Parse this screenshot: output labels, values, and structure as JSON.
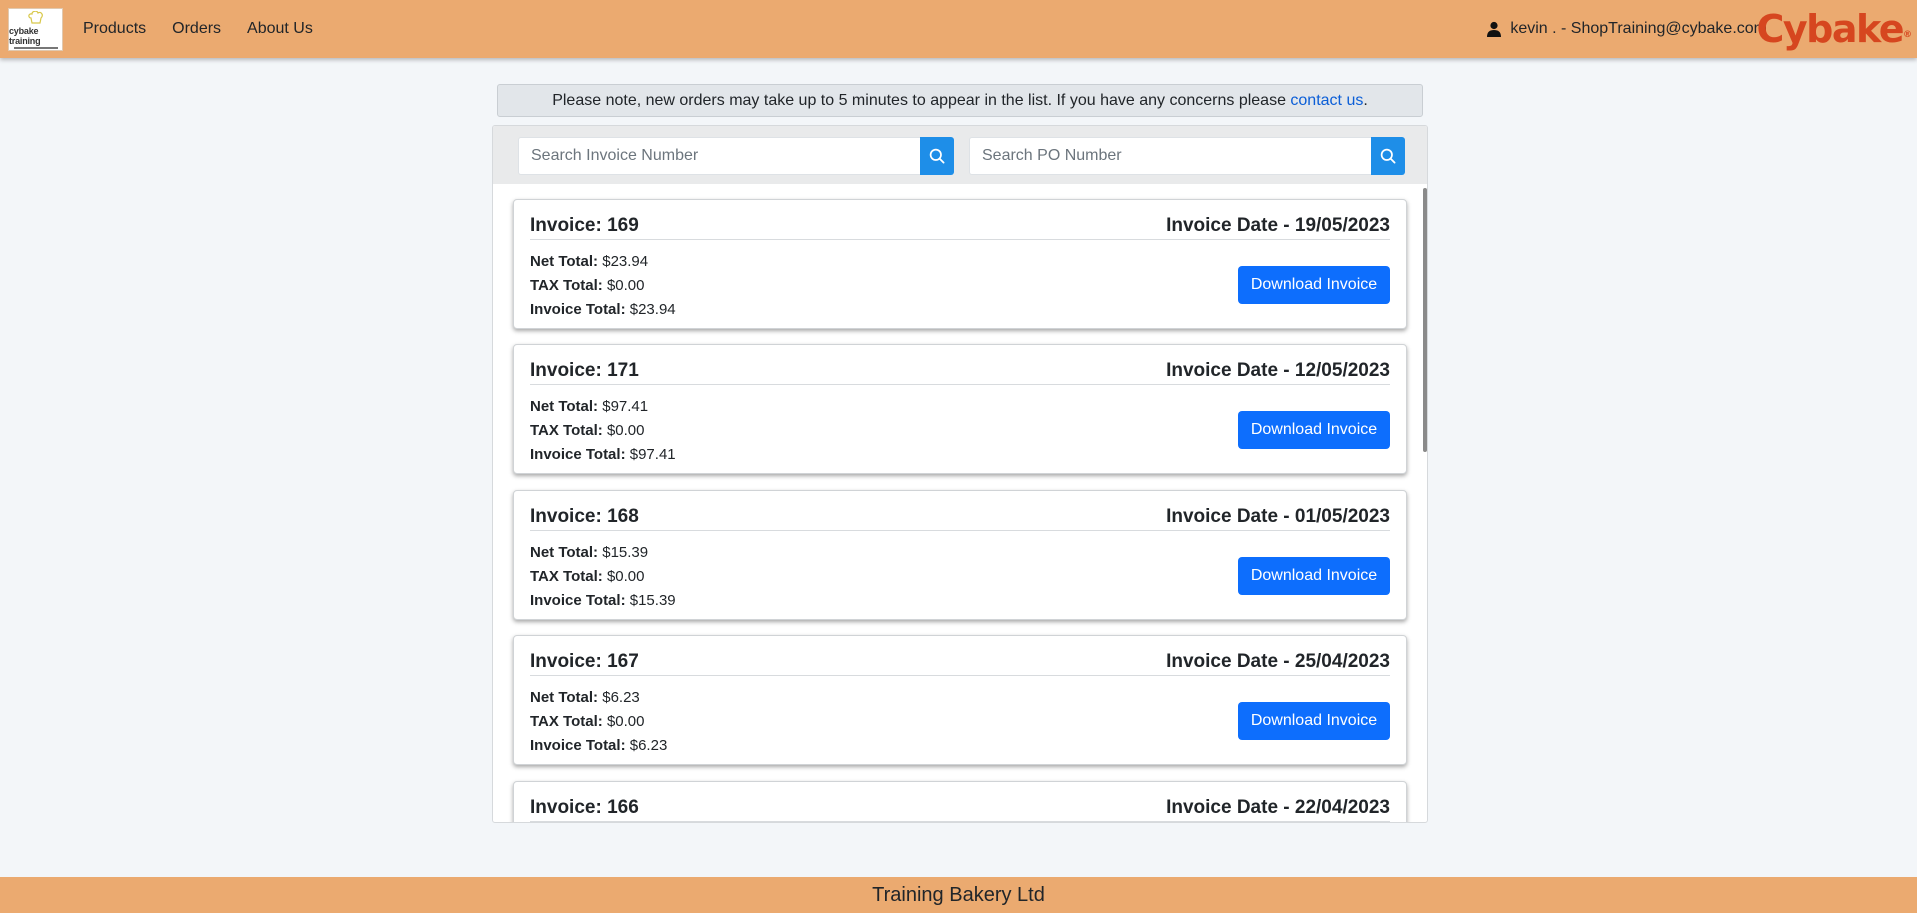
{
  "header": {
    "logo_text": "cybake training",
    "nav": [
      {
        "label": "Products"
      },
      {
        "label": "Orders"
      },
      {
        "label": "About Us"
      }
    ],
    "user_label": "kevin . - ShopTraining@cybake.com",
    "brand": "Cybake",
    "brand_mark": "®"
  },
  "notice": {
    "text": "Please note, new orders may take up to 5 minutes to appear in the list. If you have any concerns please ",
    "link": "contact us",
    "suffix": "."
  },
  "search": {
    "invoice_placeholder": "Search Invoice Number",
    "po_placeholder": "Search PO Number"
  },
  "labels": {
    "net": "Net Total:",
    "tax": "TAX Total:",
    "total": "Invoice Total:",
    "download": "Download Invoice"
  },
  "invoices": [
    {
      "title": "Invoice: 169",
      "date": "Invoice Date - 19/05/2023",
      "net": "$23.94",
      "tax": "$0.00",
      "total": "$23.94"
    },
    {
      "title": "Invoice: 171",
      "date": "Invoice Date - 12/05/2023",
      "net": "$97.41",
      "tax": "$0.00",
      "total": "$97.41"
    },
    {
      "title": "Invoice: 168",
      "date": "Invoice Date - 01/05/2023",
      "net": "$15.39",
      "tax": "$0.00",
      "total": "$15.39"
    },
    {
      "title": "Invoice: 167",
      "date": "Invoice Date - 25/04/2023",
      "net": "$6.23",
      "tax": "$0.00",
      "total": "$6.23"
    },
    {
      "title": "Invoice: 166",
      "date": "Invoice Date - 22/04/2023",
      "net": "",
      "tax": "",
      "total": ""
    }
  ],
  "footer": {
    "text": "Training Bakery Ltd"
  },
  "colors": {
    "header": "#ebaa70",
    "brand": "#d6461f",
    "primary": "#0d6efd",
    "search_button": "#1e8ee8"
  }
}
